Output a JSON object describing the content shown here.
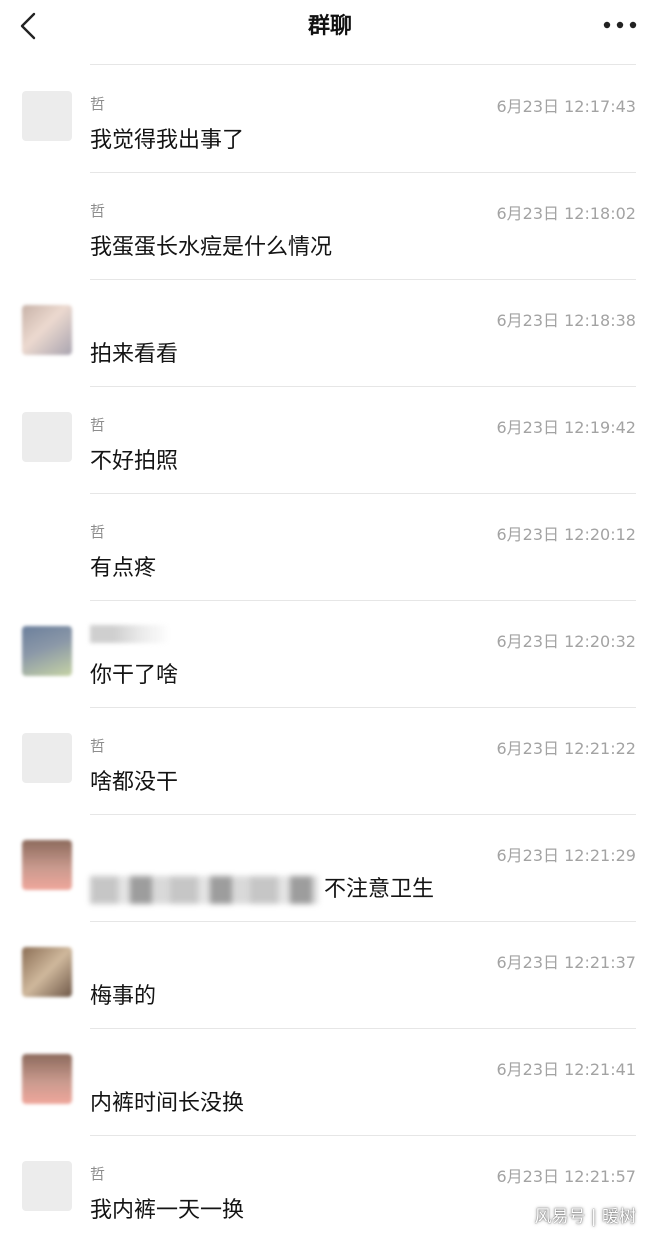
{
  "header": {
    "title": "群聊"
  },
  "messages": [
    {
      "sender": "哲",
      "time": "6月23日 12:17:43",
      "text": "我觉得我出事了",
      "avatar": "plain"
    },
    {
      "sender": "哲",
      "time": "6月23日 12:18:02",
      "text": "我蛋蛋长水痘是什么情况",
      "avatar": "none"
    },
    {
      "sender": "",
      "time": "6月23日 12:18:38",
      "text": "拍来看看",
      "avatar": "blurred-a"
    },
    {
      "sender": "哲",
      "time": "6月23日 12:19:42",
      "text": "不好拍照",
      "avatar": "plain"
    },
    {
      "sender": "哲",
      "time": "6月23日 12:20:12",
      "text": "有点疼",
      "avatar": "none"
    },
    {
      "sender": "",
      "time": "6月23日 12:20:32",
      "text": "你干了啥",
      "avatar": "blurred-b"
    },
    {
      "sender": "哲",
      "time": "6月23日 12:21:22",
      "text": "啥都没干",
      "avatar": "plain"
    },
    {
      "sender": "",
      "time": "6月23日 12:21:29",
      "text": "不注意卫生",
      "avatar": "blurred-c"
    },
    {
      "sender": "",
      "time": "6月23日 12:21:37",
      "text": "梅事的",
      "avatar": "blurred-d"
    },
    {
      "sender": "",
      "time": "6月23日 12:21:41",
      "text": "内裤时间长没换",
      "avatar": "blurred-c"
    },
    {
      "sender": "哲",
      "time": "6月23日 12:21:57",
      "text": "我内裤一天一换",
      "avatar": "plain"
    }
  ],
  "watermark": "风易号 | 暖树",
  "colors": {
    "text": "#141414",
    "meta": "#a3a3a3",
    "divider": "#e6e6e6"
  }
}
